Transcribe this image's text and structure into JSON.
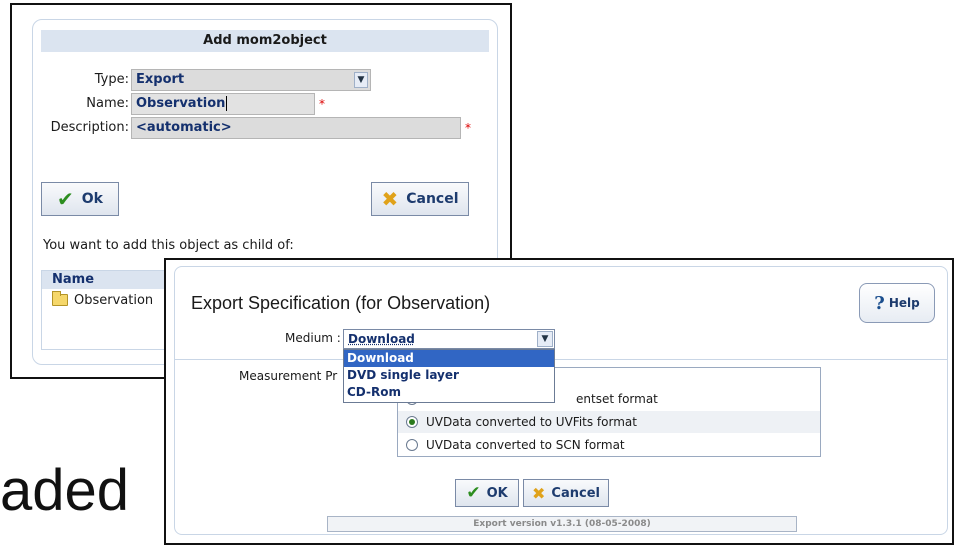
{
  "background": {
    "slide_text": "aded"
  },
  "dialog_add": {
    "title": "Add mom2object",
    "type_label": "Type:",
    "type_value": "Export",
    "name_label": "Name:",
    "name_value": "Observation",
    "description_label": "Description:",
    "description_value": "<automatic>",
    "required_marker": "*",
    "ok_label": "Ok",
    "cancel_label": "Cancel",
    "note": "You want to add this object as child of:",
    "table": {
      "header": "Name",
      "rows": [
        {
          "name": "Observation",
          "icon": "folder-icon"
        }
      ]
    }
  },
  "dialog_export": {
    "title": "Export Specification (for Observation)",
    "help_label": "Help",
    "medium_label": "Medium :",
    "medium_value": "Download",
    "medium_options": [
      "Download",
      "DVD single layer",
      "CD-Rom"
    ],
    "measurement_label": "Measurement Pr",
    "formats": [
      {
        "label": "entset format",
        "selected": false
      },
      {
        "label": "UVData converted to UVFits format",
        "selected": true
      },
      {
        "label": "UVData converted to SCN format",
        "selected": false
      }
    ],
    "ok_label": "OK",
    "cancel_label": "Cancel",
    "version": "Export version v1.3.1 (08-05-2008)"
  },
  "colors": {
    "header_bg": "#dbe4f0",
    "accent_blue": "#14306e",
    "selection": "#3166c4",
    "check_green": "#2c8d1f",
    "cancel_orange": "#e0a21a",
    "required_red": "#dd0000"
  }
}
